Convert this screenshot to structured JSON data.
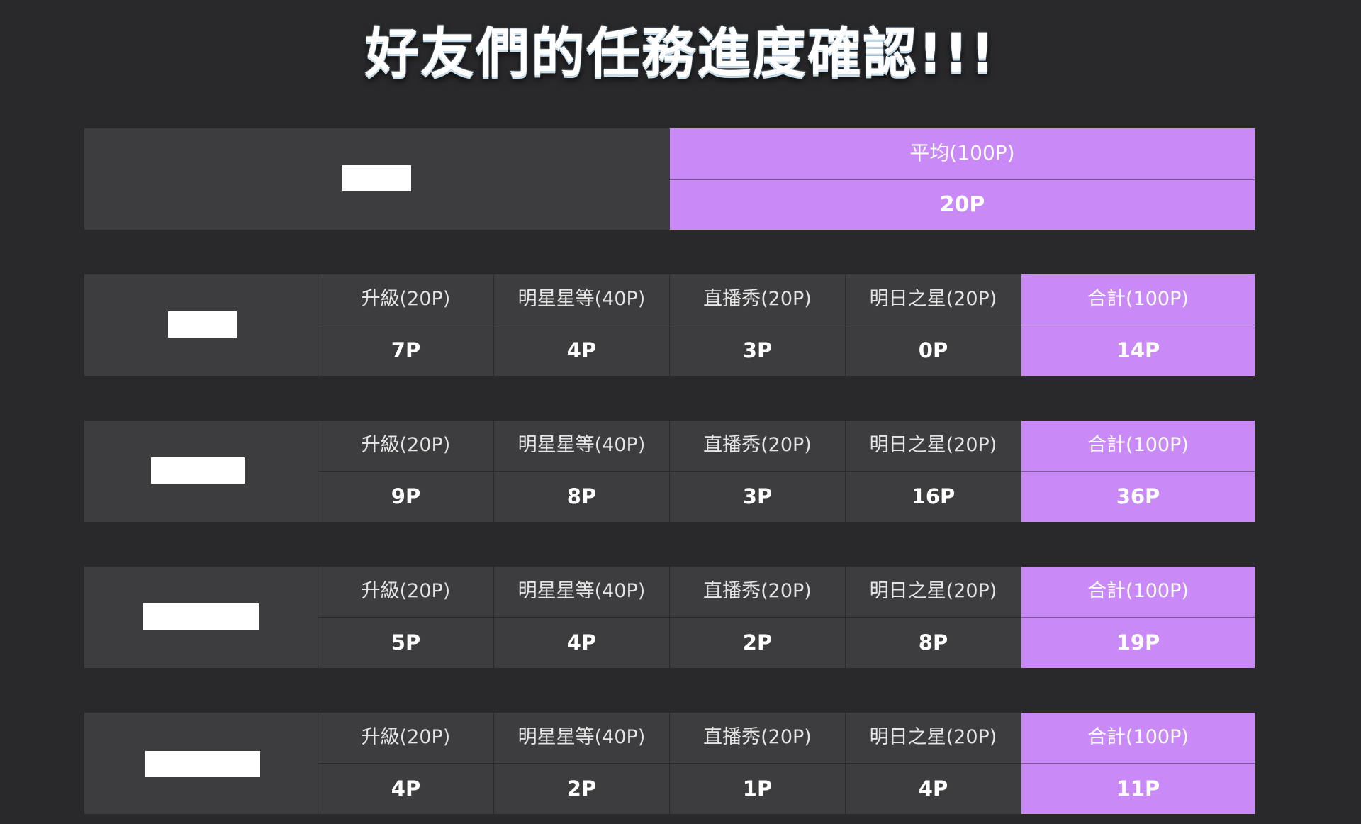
{
  "title": "好友們的任務進度確認!!!",
  "colors": {
    "background": "#29292b",
    "cell": "#3d3d3f",
    "accent": "#c98af7"
  },
  "average": {
    "label": "平均(100P)",
    "value": "20P"
  },
  "columns": [
    "升級(20P)",
    "明星星等(40P)",
    "直播秀(20P)",
    "明日之星(20P)"
  ],
  "total_label": "合計(100P)",
  "friends": [
    {
      "values": [
        "7P",
        "4P",
        "3P",
        "0P"
      ],
      "total": "14P"
    },
    {
      "values": [
        "9P",
        "8P",
        "3P",
        "16P"
      ],
      "total": "36P"
    },
    {
      "values": [
        "5P",
        "4P",
        "2P",
        "8P"
      ],
      "total": "19P"
    },
    {
      "values": [
        "4P",
        "2P",
        "1P",
        "4P"
      ],
      "total": "11P"
    }
  ]
}
